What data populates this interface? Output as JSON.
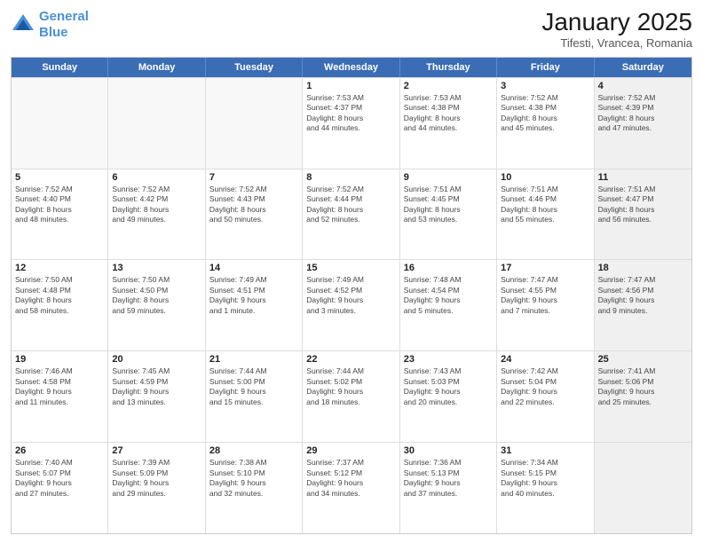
{
  "header": {
    "logo_line1": "General",
    "logo_line2": "Blue",
    "month": "January 2025",
    "location": "Tifesti, Vrancea, Romania"
  },
  "days_of_week": [
    "Sunday",
    "Monday",
    "Tuesday",
    "Wednesday",
    "Thursday",
    "Friday",
    "Saturday"
  ],
  "weeks": [
    [
      {
        "day": "",
        "text": "",
        "empty": true
      },
      {
        "day": "",
        "text": "",
        "empty": true
      },
      {
        "day": "",
        "text": "",
        "empty": true
      },
      {
        "day": "1",
        "text": "Sunrise: 7:53 AM\nSunset: 4:37 PM\nDaylight: 8 hours\nand 44 minutes."
      },
      {
        "day": "2",
        "text": "Sunrise: 7:53 AM\nSunset: 4:38 PM\nDaylight: 8 hours\nand 44 minutes."
      },
      {
        "day": "3",
        "text": "Sunrise: 7:52 AM\nSunset: 4:38 PM\nDaylight: 8 hours\nand 45 minutes."
      },
      {
        "day": "4",
        "text": "Sunrise: 7:52 AM\nSunset: 4:39 PM\nDaylight: 8 hours\nand 47 minutes.",
        "shaded": true
      }
    ],
    [
      {
        "day": "5",
        "text": "Sunrise: 7:52 AM\nSunset: 4:40 PM\nDaylight: 8 hours\nand 48 minutes."
      },
      {
        "day": "6",
        "text": "Sunrise: 7:52 AM\nSunset: 4:42 PM\nDaylight: 8 hours\nand 49 minutes."
      },
      {
        "day": "7",
        "text": "Sunrise: 7:52 AM\nSunset: 4:43 PM\nDaylight: 8 hours\nand 50 minutes."
      },
      {
        "day": "8",
        "text": "Sunrise: 7:52 AM\nSunset: 4:44 PM\nDaylight: 8 hours\nand 52 minutes."
      },
      {
        "day": "9",
        "text": "Sunrise: 7:51 AM\nSunset: 4:45 PM\nDaylight: 8 hours\nand 53 minutes."
      },
      {
        "day": "10",
        "text": "Sunrise: 7:51 AM\nSunset: 4:46 PM\nDaylight: 8 hours\nand 55 minutes."
      },
      {
        "day": "11",
        "text": "Sunrise: 7:51 AM\nSunset: 4:47 PM\nDaylight: 8 hours\nand 56 minutes.",
        "shaded": true
      }
    ],
    [
      {
        "day": "12",
        "text": "Sunrise: 7:50 AM\nSunset: 4:48 PM\nDaylight: 8 hours\nand 58 minutes."
      },
      {
        "day": "13",
        "text": "Sunrise: 7:50 AM\nSunset: 4:50 PM\nDaylight: 8 hours\nand 59 minutes."
      },
      {
        "day": "14",
        "text": "Sunrise: 7:49 AM\nSunset: 4:51 PM\nDaylight: 9 hours\nand 1 minute."
      },
      {
        "day": "15",
        "text": "Sunrise: 7:49 AM\nSunset: 4:52 PM\nDaylight: 9 hours\nand 3 minutes."
      },
      {
        "day": "16",
        "text": "Sunrise: 7:48 AM\nSunset: 4:54 PM\nDaylight: 9 hours\nand 5 minutes."
      },
      {
        "day": "17",
        "text": "Sunrise: 7:47 AM\nSunset: 4:55 PM\nDaylight: 9 hours\nand 7 minutes."
      },
      {
        "day": "18",
        "text": "Sunrise: 7:47 AM\nSunset: 4:56 PM\nDaylight: 9 hours\nand 9 minutes.",
        "shaded": true
      }
    ],
    [
      {
        "day": "19",
        "text": "Sunrise: 7:46 AM\nSunset: 4:58 PM\nDaylight: 9 hours\nand 11 minutes."
      },
      {
        "day": "20",
        "text": "Sunrise: 7:45 AM\nSunset: 4:59 PM\nDaylight: 9 hours\nand 13 minutes."
      },
      {
        "day": "21",
        "text": "Sunrise: 7:44 AM\nSunset: 5:00 PM\nDaylight: 9 hours\nand 15 minutes."
      },
      {
        "day": "22",
        "text": "Sunrise: 7:44 AM\nSunset: 5:02 PM\nDaylight: 9 hours\nand 18 minutes."
      },
      {
        "day": "23",
        "text": "Sunrise: 7:43 AM\nSunset: 5:03 PM\nDaylight: 9 hours\nand 20 minutes."
      },
      {
        "day": "24",
        "text": "Sunrise: 7:42 AM\nSunset: 5:04 PM\nDaylight: 9 hours\nand 22 minutes."
      },
      {
        "day": "25",
        "text": "Sunrise: 7:41 AM\nSunset: 5:06 PM\nDaylight: 9 hours\nand 25 minutes.",
        "shaded": true
      }
    ],
    [
      {
        "day": "26",
        "text": "Sunrise: 7:40 AM\nSunset: 5:07 PM\nDaylight: 9 hours\nand 27 minutes."
      },
      {
        "day": "27",
        "text": "Sunrise: 7:39 AM\nSunset: 5:09 PM\nDaylight: 9 hours\nand 29 minutes."
      },
      {
        "day": "28",
        "text": "Sunrise: 7:38 AM\nSunset: 5:10 PM\nDaylight: 9 hours\nand 32 minutes."
      },
      {
        "day": "29",
        "text": "Sunrise: 7:37 AM\nSunset: 5:12 PM\nDaylight: 9 hours\nand 34 minutes."
      },
      {
        "day": "30",
        "text": "Sunrise: 7:36 AM\nSunset: 5:13 PM\nDaylight: 9 hours\nand 37 minutes."
      },
      {
        "day": "31",
        "text": "Sunrise: 7:34 AM\nSunset: 5:15 PM\nDaylight: 9 hours\nand 40 minutes."
      },
      {
        "day": "",
        "text": "",
        "empty": true,
        "shaded": true
      }
    ]
  ]
}
